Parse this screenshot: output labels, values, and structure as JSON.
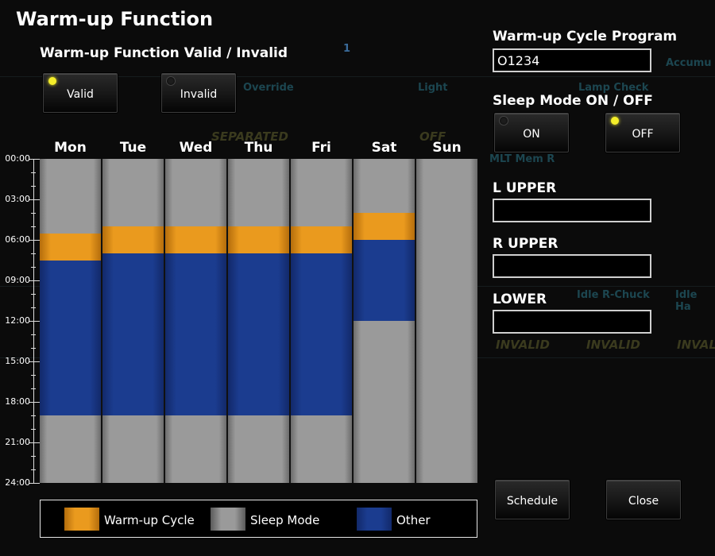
{
  "window": {
    "title": "Warm-up Function"
  },
  "warmup_valid": {
    "label": "Warm-up Function Valid / Invalid",
    "valid_label": "Valid",
    "invalid_label": "Invalid",
    "selected": "Valid"
  },
  "program": {
    "label": "Warm-up Cycle Program",
    "value": "O1234"
  },
  "sleep_mode": {
    "label": "Sleep Mode ON / OFF",
    "on_label": "ON",
    "off_label": "OFF",
    "selected": "OFF"
  },
  "fields": [
    {
      "label": "L UPPER",
      "value": ""
    },
    {
      "label": "R UPPER",
      "value": ""
    },
    {
      "label": "LOWER",
      "value": ""
    }
  ],
  "buttons": {
    "schedule": "Schedule",
    "close": "Close"
  },
  "chart_data": {
    "type": "gantt",
    "days": [
      "Mon",
      "Tue",
      "Wed",
      "Thu",
      "Fri",
      "Sat",
      "Sun"
    ],
    "time_ticks": [
      "00:00",
      "03:00",
      "06:00",
      "09:00",
      "12:00",
      "15:00",
      "18:00",
      "21:00",
      "24:00"
    ],
    "y_range_hours": [
      0,
      24
    ],
    "segments": [
      {
        "day": "Mon",
        "type": "warm",
        "start": 5.5,
        "end": 7.5
      },
      {
        "day": "Mon",
        "type": "other",
        "start": 7.5,
        "end": 19.0
      },
      {
        "day": "Tue",
        "type": "warm",
        "start": 5.0,
        "end": 7.0
      },
      {
        "day": "Tue",
        "type": "other",
        "start": 7.0,
        "end": 19.0
      },
      {
        "day": "Wed",
        "type": "warm",
        "start": 5.0,
        "end": 7.0
      },
      {
        "day": "Wed",
        "type": "other",
        "start": 7.0,
        "end": 19.0
      },
      {
        "day": "Thu",
        "type": "warm",
        "start": 5.0,
        "end": 7.0
      },
      {
        "day": "Thu",
        "type": "other",
        "start": 7.0,
        "end": 19.0
      },
      {
        "day": "Fri",
        "type": "warm",
        "start": 5.0,
        "end": 7.0
      },
      {
        "day": "Fri",
        "type": "other",
        "start": 7.0,
        "end": 19.0
      },
      {
        "day": "Sat",
        "type": "warm",
        "start": 4.0,
        "end": 6.0
      },
      {
        "day": "Sat",
        "type": "other",
        "start": 6.0,
        "end": 12.0
      }
    ],
    "default_state": "sleep"
  },
  "legend": [
    {
      "type": "warm",
      "label": "Warm-up Cycle"
    },
    {
      "type": "sleep",
      "label": "Sleep Mode"
    },
    {
      "type": "other",
      "label": "Other"
    }
  ],
  "colors": {
    "warm": "#ea9a1e",
    "sleep": "#9a9a9a",
    "other": "#1b3c8f",
    "lamp_on": "#f4ee2a"
  },
  "background_ghost": {
    "texts": [
      "Override",
      "Light",
      "Lamp Check",
      "SEPARATED",
      "OFF",
      "MLT Mem R",
      "Idle R-Chuck",
      "Idle Ha",
      "INVALID",
      "INVALID",
      "INVAL",
      "Accumu",
      "1"
    ]
  }
}
